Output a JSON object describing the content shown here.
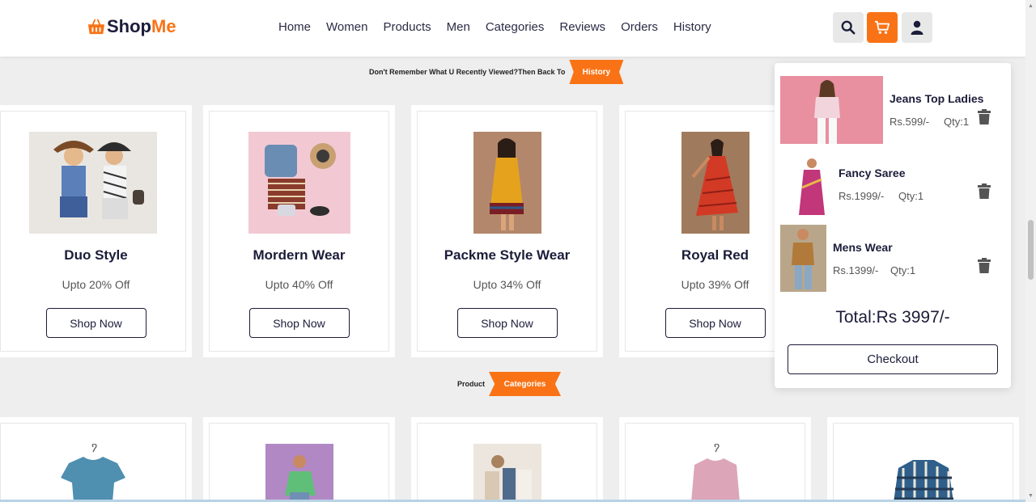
{
  "brand": {
    "name_dark": "Shop",
    "name_accent": "Me",
    "accent_color": "#f97316",
    "icon": "basket-icon"
  },
  "nav": [
    "Home",
    "Women",
    "Products",
    "Men",
    "Categories",
    "Reviews",
    "Orders",
    "History"
  ],
  "header_buttons": [
    {
      "name": "search-button",
      "icon": "search-icon"
    },
    {
      "name": "cart-button",
      "icon": "cart-icon"
    },
    {
      "name": "account-button",
      "icon": "user-icon"
    }
  ],
  "history_banner": {
    "text": "Don't Remember What U Recently Viewed?Then Back To",
    "ribbon": "History"
  },
  "products": [
    {
      "title": "Duo Style",
      "offer": "Upto 20% Off",
      "button": "Shop Now"
    },
    {
      "title": "Mordern Wear",
      "offer": "Upto 40% Off",
      "button": "Shop Now"
    },
    {
      "title": "Packme Style Wear",
      "offer": "Upto 34% Off",
      "button": "Shop Now"
    },
    {
      "title": "Royal Red",
      "offer": "Upto 39% Off",
      "button": "Shop Now"
    }
  ],
  "categories_banner": {
    "text": "Product",
    "ribbon": "Categories"
  },
  "cart": {
    "items": [
      {
        "name": "Jeans Top Ladies",
        "price": "Rs.599/-",
        "qty": "Qty:1"
      },
      {
        "name": "Fancy Saree",
        "price": "Rs.1999/-",
        "qty": "Qty:1"
      },
      {
        "name": "Mens Wear",
        "price": "Rs.1399/-",
        "qty": "Qty:1"
      }
    ],
    "total": "Total:Rs 3997/-",
    "checkout": "Checkout"
  }
}
